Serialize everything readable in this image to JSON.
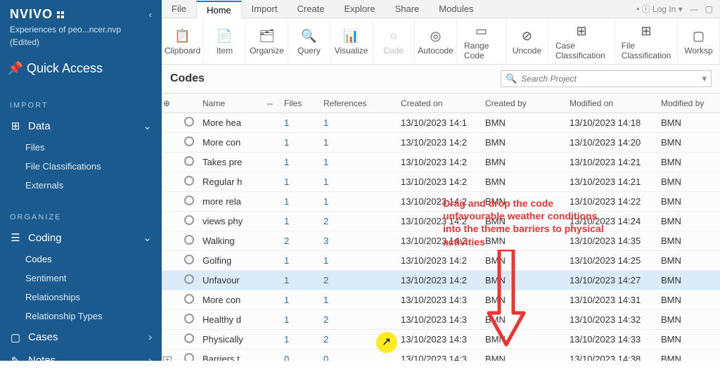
{
  "brand": "NVIVO",
  "project_name": "Experiences of peo...ncer.nvp",
  "edited_label": "(Edited)",
  "quick_access": "Quick Access",
  "sidebar": {
    "section_import": "IMPORT",
    "data": {
      "label": "Data",
      "items": [
        "Files",
        "File Classifications",
        "Externals"
      ]
    },
    "section_organize": "ORGANIZE",
    "coding": {
      "label": "Coding",
      "items": [
        "Codes",
        "Sentiment",
        "Relationships",
        "Relationship Types"
      ]
    },
    "cases": "Cases",
    "notes": "Notes"
  },
  "tabs": [
    "File",
    "Home",
    "Import",
    "Create",
    "Explore",
    "Share",
    "Modules"
  ],
  "tab_active": 1,
  "tab_right": {
    "login": "Log In"
  },
  "ribbon": [
    {
      "icon": "📋",
      "label": "Clipboard"
    },
    {
      "icon": "📄",
      "label": "Item"
    },
    {
      "icon": "🗂",
      "label": "Organize"
    },
    {
      "icon": "🔍",
      "label": "Query"
    },
    {
      "icon": "📊",
      "label": "Visualize"
    },
    {
      "icon": "○",
      "label": "Code",
      "disabled": true
    },
    {
      "icon": "◎",
      "label": "Autocode"
    },
    {
      "icon": "▭",
      "label": "Range Code"
    },
    {
      "icon": "⊘",
      "label": "Uncode"
    },
    {
      "icon": "⊞",
      "label": "Case Classification"
    },
    {
      "icon": "⊞",
      "label": "File Classification"
    },
    {
      "icon": "▢",
      "label": "Worksp"
    }
  ],
  "content": {
    "title": "Codes",
    "search_placeholder": "Search Project"
  },
  "columns": {
    "expand": "⊕",
    "circle": "",
    "name": "Name",
    "link": "⇔",
    "files": "Files",
    "refs": "References",
    "created_on": "Created on",
    "created_by": "Created by",
    "modified_on": "Modified on",
    "modified_by": "Modified by"
  },
  "rows": [
    {
      "name": "More hea",
      "files": "1",
      "refs": "1",
      "con": "13/10/2023 14:1",
      "cby": "BMN",
      "mon": "13/10/2023 14:18",
      "mby": "BMN"
    },
    {
      "name": "More con",
      "files": "1",
      "refs": "1",
      "con": "13/10/2023 14:2",
      "cby": "BMN",
      "mon": "13/10/2023 14:20",
      "mby": "BMN"
    },
    {
      "name": "Takes pre",
      "files": "1",
      "refs": "1",
      "con": "13/10/2023 14:2",
      "cby": "BMN",
      "mon": "13/10/2023 14:21",
      "mby": "BMN"
    },
    {
      "name": "Regular h",
      "files": "1",
      "refs": "1",
      "con": "13/10/2023 14:2",
      "cby": "BMN",
      "mon": "13/10/2023 14:21",
      "mby": "BMN"
    },
    {
      "name": "more rela",
      "files": "1",
      "refs": "1",
      "con": "13/10/2023 14:2",
      "cby": "BMN",
      "mon": "13/10/2023 14:22",
      "mby": "BMN"
    },
    {
      "name": "views phy",
      "files": "1",
      "refs": "2",
      "con": "13/10/2023 14:2",
      "cby": "BMN",
      "mon": "13/10/2023 14:24",
      "mby": "BMN"
    },
    {
      "name": "Walking",
      "files": "2",
      "refs": "3",
      "con": "13/10/2023 14:2",
      "cby": "BMN",
      "mon": "13/10/2023 14:35",
      "mby": "BMN"
    },
    {
      "name": "Golfing",
      "files": "1",
      "refs": "1",
      "con": "13/10/2023 14:2",
      "cby": "BMN",
      "mon": "13/10/2023 14:25",
      "mby": "BMN"
    },
    {
      "name": "Unfavour",
      "files": "1",
      "refs": "2",
      "con": "13/10/2023 14:2",
      "cby": "BMN",
      "mon": "13/10/2023 14:27",
      "mby": "BMN",
      "selected": true
    },
    {
      "name": "More con",
      "files": "1",
      "refs": "1",
      "con": "13/10/2023 14:3",
      "cby": "BMN",
      "mon": "13/10/2023 14:31",
      "mby": "BMN"
    },
    {
      "name": "Healthy d",
      "files": "1",
      "refs": "2",
      "con": "13/10/2023 14:3",
      "cby": "BMN",
      "mon": "13/10/2023 14:32",
      "mby": "BMN"
    },
    {
      "name": "Physically",
      "files": "1",
      "refs": "2",
      "con": "13/10/2023 14:3",
      "cby": "BMN",
      "mon": "13/10/2023 14:33",
      "mby": "BMN"
    },
    {
      "name": "Barriers t",
      "files": "0",
      "refs": "0",
      "con": "13/10/2023 14:3",
      "cby": "BMN",
      "mon": "13/10/2023 14:38",
      "mby": "BMN",
      "expand": true
    }
  ],
  "annotation": {
    "line1": "Drag and drop the code",
    "line2": "unfavourable weather conditions",
    "line3": "into  the theme barriers to physical",
    "line4": "activities"
  }
}
